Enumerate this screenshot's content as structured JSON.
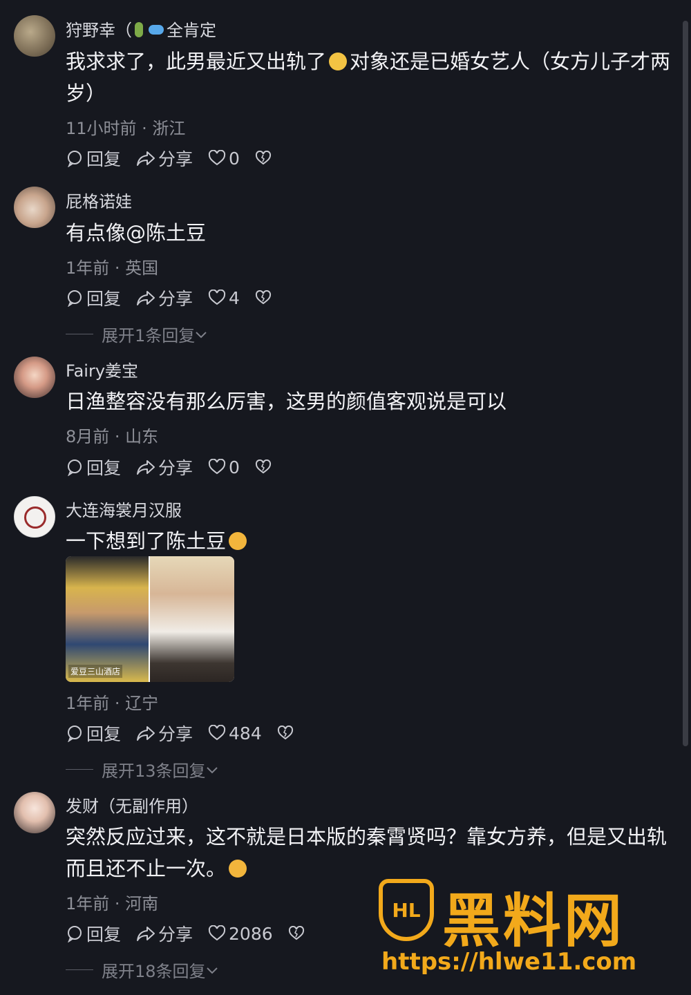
{
  "comments": [
    {
      "username": "狩野幸（",
      "username_suffix": "全肯定",
      "text_a": "我求求了，此男最近又出轨了",
      "text_b": "对象还是已婚女艺人（女方儿子才两岁）",
      "meta": "11小时前 · 浙江",
      "reply": "回复",
      "share": "分享",
      "likes": "0"
    },
    {
      "username": "屁格诺娃",
      "text_a": "有点像@陈土豆",
      "meta": "1年前 · 英国",
      "reply": "回复",
      "share": "分享",
      "likes": "4",
      "expand": "展开1条回复"
    },
    {
      "username": "Fairy姜宝",
      "text_a": "日渔整容没有那么厉害，这男的颜值客观说是可以",
      "meta": "8月前 · 山东",
      "reply": "回复",
      "share": "分享",
      "likes": "0"
    },
    {
      "username": "大连海裳月汉服",
      "text_a": "一下想到了陈土豆",
      "image_caption": "爱豆三山酒店",
      "meta": "1年前 · 辽宁",
      "reply": "回复",
      "share": "分享",
      "likes": "484",
      "expand": "展开13条回复"
    },
    {
      "username": "发财（无副作用）",
      "text_a": "突然反应过来，这不就是日本版的秦霄贤吗？靠女方养，但是又出轨而且还不止一次。",
      "meta": "1年前 · 河南",
      "reply": "回复",
      "share": "分享",
      "likes": "2086",
      "expand": "展开18条回复"
    }
  ],
  "watermark": {
    "logo_letters": "HL",
    "title": "黑料网",
    "url": "https://hlwe11.com"
  },
  "colors": {
    "background": "#16181f",
    "watermark": "#f2a91b"
  },
  "icons": [
    "comment-bubble-icon",
    "share-arrow-icon",
    "heart-icon",
    "broken-heart-icon",
    "chevron-down-icon"
  ]
}
